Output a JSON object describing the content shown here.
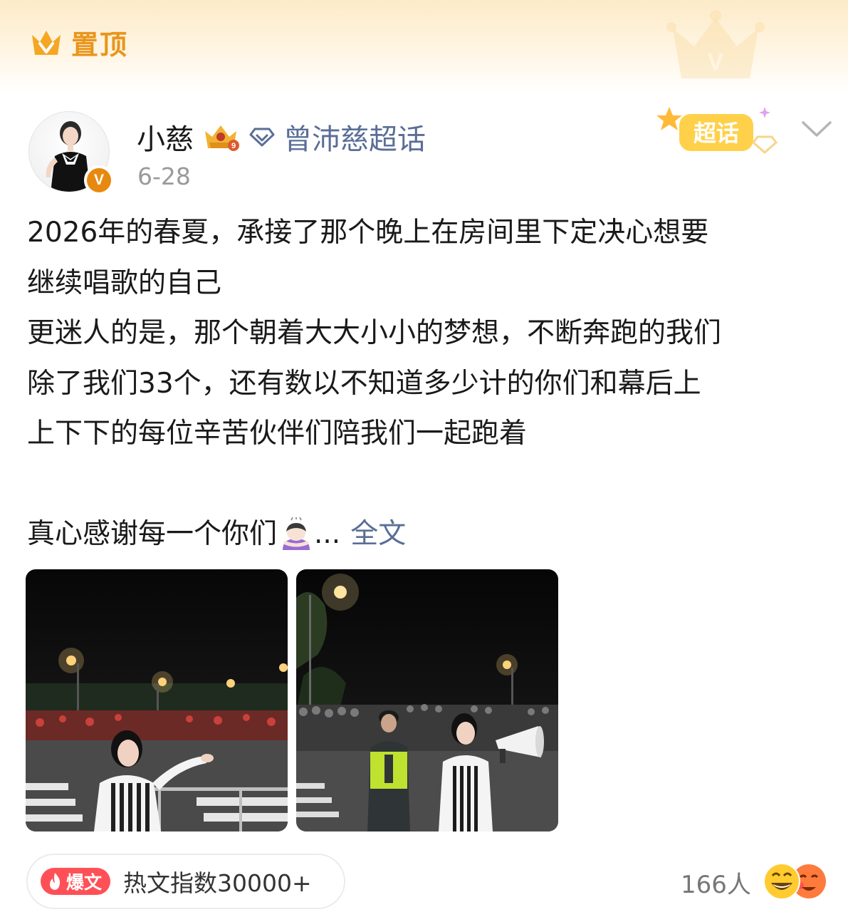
{
  "pinned": {
    "label": "置顶",
    "icon": "crown-v-icon",
    "accent": "#e9951c"
  },
  "author": {
    "name": "小慈",
    "vip_icon": "vip-crown-icon",
    "verified_badge": "V",
    "topic_icon": "diamond-topic-icon",
    "topic": "曾沛慈超话",
    "date": "6-28"
  },
  "chaohua_tag": {
    "label": "超话",
    "color": "#f5b300"
  },
  "post": {
    "lines": [
      "2026年的春夏，承接了那个晚上在房间里下定决心想要",
      "继续唱歌的自己",
      "更迷人的是，那个朝着大大小小的梦想，不断奔跑的我们",
      "除了我们33个，还有数以不知道多少计的你们和幕后上",
      "上下下的每位辛苦伙伴们陪我们一起跑着"
    ],
    "last_line": "真心感谢每一个你们",
    "ellipsis": "...",
    "full_text_link": "全文",
    "link_color": "#5a6e96"
  },
  "photos": [
    {
      "alt": "night-street-photo-1"
    },
    {
      "alt": "night-street-photo-2"
    }
  ],
  "hot": {
    "badge": "爆文",
    "text": "热文指数30000+",
    "badge_color": "#ff5057"
  },
  "reactions": {
    "count": "166人"
  }
}
